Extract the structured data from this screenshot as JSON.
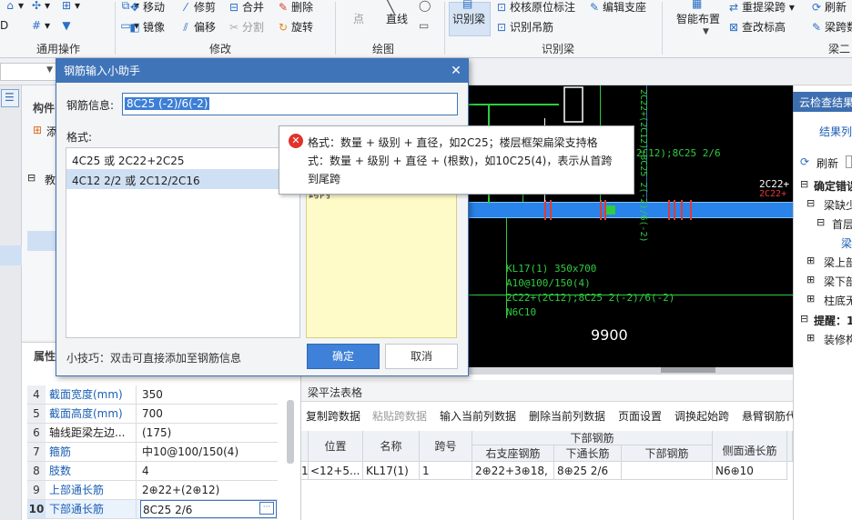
{
  "ribbon": {
    "common_ops": {
      "group_label": "通用操作"
    },
    "modify": {
      "group_label": "修改",
      "move": "移动",
      "trim": "修剪",
      "merge": "合并",
      "delete": "删除",
      "mirror": "镜像",
      "offset": "偏移",
      "split": "分割",
      "rotate": "旋转"
    },
    "draw": {
      "group_label": "绘图",
      "point": "点",
      "line": "直线"
    },
    "recognize_beam": {
      "group_label": "识别梁",
      "recognize": "识别梁",
      "verify_annotation": "校核原位标注",
      "edit_support": "编辑支座",
      "recognize_stirrup": "识别吊筋"
    },
    "beam2": {
      "group_label": "梁二",
      "smart_layout": "智能布置",
      "reextract_span": "重提梁跨",
      "check_elevation": "查改标高",
      "refresh": "刷新",
      "beam_span_data": "梁跨数"
    }
  },
  "left": {
    "panel_title": "构件",
    "add_label": "添",
    "tree_item": "教",
    "props_title": "属性"
  },
  "properties": [
    {
      "no": "4",
      "name": "截面宽度(mm)",
      "value": "350",
      "blue": true
    },
    {
      "no": "5",
      "name": "截面高度(mm)",
      "value": "700",
      "blue": true
    },
    {
      "no": "6",
      "name": "轴线距梁左边...",
      "value": "(175)",
      "blue": false
    },
    {
      "no": "7",
      "name": "箍筋",
      "value": "中10@100/150(4)",
      "blue": true
    },
    {
      "no": "8",
      "name": "肢数",
      "value": "4",
      "blue": true
    },
    {
      "no": "9",
      "name": "上部通长筋",
      "value": "2⊕22+(2⊕12)",
      "blue": true
    },
    {
      "no": "10",
      "name": "下部通长筋",
      "value": "8C25 2/6",
      "blue": true
    }
  ],
  "dialog": {
    "title": "钢筋输入小助手",
    "info_label": "钢筋信息:",
    "info_value": "8C25 (-2)/6(-2)",
    "format_label": "格式:",
    "formats": [
      "4C25 或 2C22+2C25",
      "4C12 2/2 或 2C12/2C16"
    ],
    "hint_fragment": "跨内",
    "tip": "小技巧：双击可直接添加至钢筋信息",
    "ok": "确定",
    "cancel": "取消"
  },
  "tooltip": {
    "line1": "格式：数量 + 级别 + 直径，如2C25；楼层框架扁梁支持格",
    "line2": "式：数量 + 级别 + 直径 + (根数)，如10C25(4)，表示从首跨",
    "line3": "到尾跨"
  },
  "canvas": {
    "label_kl": "KL17(1) 350x700",
    "label_stirrup": "A10@100/150(4)",
    "label_top": "2C22+(2C12);8C25 2(-2)/6(-2)",
    "label_n": "N6C10",
    "label_top_right": "2+(2C12);8C25 2/6",
    "label_00": "00",
    "label_2c22": "2C22+",
    "label_2c22b": "2C22+",
    "dimension": "9900",
    "v_label": "2C22+(2C12);8C25 2(-2)/6(-2)"
  },
  "right_panel": {
    "title": "云检查结果",
    "results_tab": "结果列",
    "refresh": "刷新",
    "items": [
      "确定错误",
      "梁缺少",
      "首层",
      "梁",
      "梁上部",
      "梁下部",
      "柱底无",
      "提醒：1",
      "装修构"
    ]
  },
  "beam_table": {
    "title": "梁平法表格",
    "toolbar": [
      "复制跨数据",
      "粘贴跨数据",
      "输入当前列数据",
      "删除当前列数据",
      "页面设置",
      "调换起始跨",
      "悬臂钢筋代"
    ],
    "group_header": "下部钢筋",
    "headers": [
      "位置",
      "名称",
      "跨号",
      "右支座钢筋",
      "下通长筋",
      "下部钢筋",
      "侧面通长筋"
    ],
    "row": {
      "no": "1",
      "position": "<12+5...",
      "name": "KL17(1)",
      "span": "1",
      "right_support": "2⊕22+3⊕18,",
      "bottom_through": "8⊕25 2/6",
      "bottom_rebar": "",
      "side_through": "N6⊕10"
    }
  }
}
